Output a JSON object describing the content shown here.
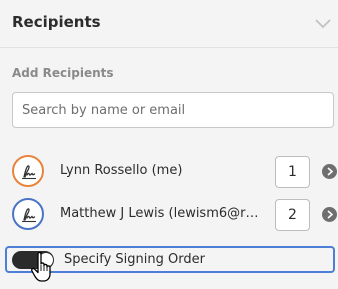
{
  "recipients_section": {
    "title": "Recipients",
    "add_label": "Add Recipients",
    "search": {
      "placeholder": "Search by name or email",
      "value": ""
    },
    "list": [
      {
        "name": "Lynn Rossello (me)",
        "order": "1",
        "avatar_icon": "signature-icon",
        "avatar_color": "#e8843c"
      },
      {
        "name": "Matthew J Lewis (lewism6@rpi.edu)",
        "order": "2",
        "avatar_icon": "signature-icon",
        "avatar_color": "#4a74c8"
      }
    ],
    "signing_order": {
      "label": "Specify Signing Order",
      "enabled": true
    }
  },
  "colors": {
    "focus_outline": "#4d7fd8",
    "toggle_on": "#2b2b2b"
  },
  "icons": {
    "collapse": "chevron-down-icon",
    "next": "arrow-right-icon",
    "pointer": "hand-cursor-icon"
  }
}
